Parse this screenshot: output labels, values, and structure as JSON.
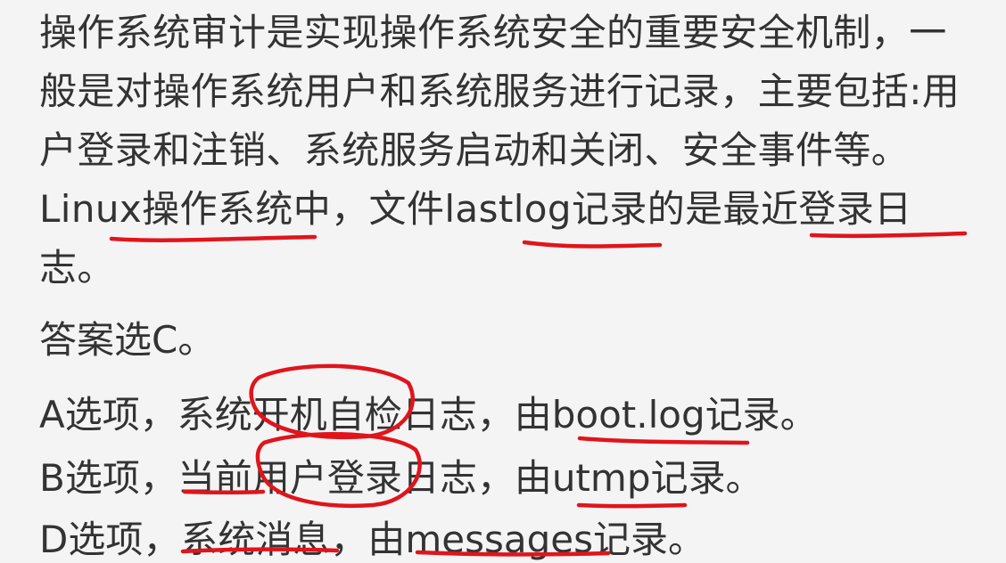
{
  "explanation": {
    "paragraph": "操作系统审计是实现操作系统安全的重要安全机制，一般是对操作系统用户和系统服务进行记录，主要包括:用户登录和注销、系统服务启动和关闭、安全事件等。Linux操作系统中，文件lastlog记录的是最近登录日志。"
  },
  "answer_line": "答案选C。",
  "options": [
    {
      "text": "A选项，系统开机自检日志，由boot.log记录。"
    },
    {
      "text": "B选项，当前用户登录日志，由utmp记录。"
    },
    {
      "text": "D选项，系统消息，由messages记录。"
    }
  ],
  "annotation_color": "#e1141b"
}
